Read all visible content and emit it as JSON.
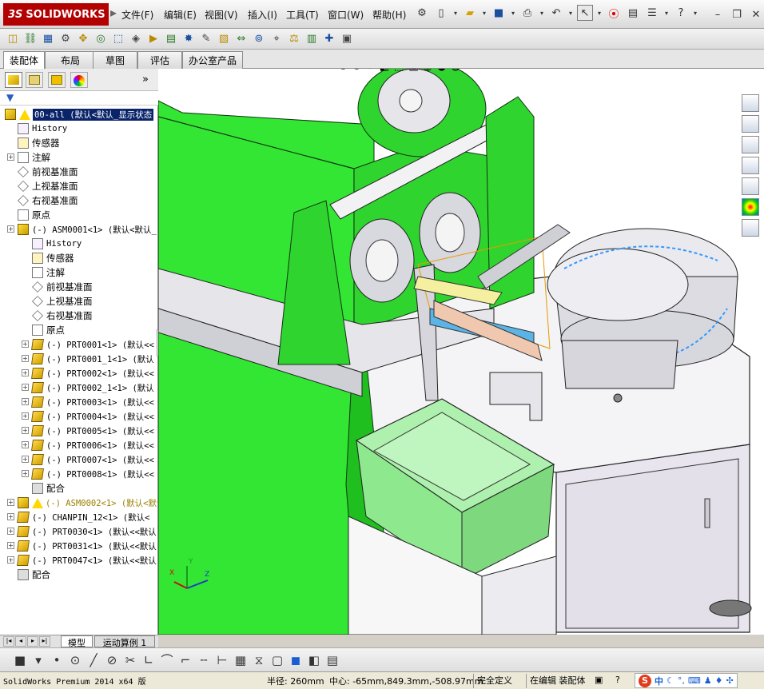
{
  "app": {
    "logo_prefix": "3S",
    "logo_text": "SOLIDWORKS"
  },
  "menu": [
    {
      "label": "文件(F)"
    },
    {
      "label": "编辑(E)"
    },
    {
      "label": "视图(V)"
    },
    {
      "label": "插入(I)"
    },
    {
      "label": "工具(T)"
    },
    {
      "label": "窗口(W)"
    },
    {
      "label": "帮助(H)"
    }
  ],
  "help_glyph": "?",
  "cm_tabs": [
    {
      "label": "装配体",
      "active": true
    },
    {
      "label": "布局",
      "active": false
    },
    {
      "label": "草图",
      "active": false
    },
    {
      "label": "评估",
      "active": false
    },
    {
      "label": "办公室产品",
      "active": false
    }
  ],
  "tree": {
    "root": {
      "label": "00-all  (默认<默认_显示状态",
      "icon": "assembly-warning-icon",
      "selected": true
    },
    "items": [
      {
        "label": "History",
        "icon": "history-icon",
        "indent": 1,
        "mono": true
      },
      {
        "label": "传感器",
        "icon": "sensor-icon",
        "indent": 1
      },
      {
        "label": "注解",
        "icon": "annotation-icon",
        "indent": 1,
        "expand": true
      },
      {
        "label": "前视基准面",
        "icon": "plane-icon",
        "indent": 1
      },
      {
        "label": "上视基准面",
        "icon": "plane-icon",
        "indent": 1
      },
      {
        "label": "右视基准面",
        "icon": "plane-icon",
        "indent": 1
      },
      {
        "label": "原点",
        "icon": "origin-icon",
        "indent": 1
      },
      {
        "label": "(-) ASM0001<1> (默认<默认_",
        "icon": "subassembly-icon",
        "indent": 1,
        "expand": true,
        "mono": true
      },
      {
        "label": "History",
        "icon": "history-icon",
        "indent": 2,
        "mono": true
      },
      {
        "label": "传感器",
        "icon": "sensor-icon",
        "indent": 2
      },
      {
        "label": "注解",
        "icon": "annotation-icon",
        "indent": 2
      },
      {
        "label": "前视基准面",
        "icon": "plane-icon",
        "indent": 2
      },
      {
        "label": "上视基准面",
        "icon": "plane-icon",
        "indent": 2
      },
      {
        "label": "右视基准面",
        "icon": "plane-icon",
        "indent": 2
      },
      {
        "label": "原点",
        "icon": "origin-icon",
        "indent": 2
      },
      {
        "label": "(-) PRT0001<1> (默认<<",
        "icon": "part-icon",
        "indent": 2,
        "expand": true,
        "mono": true
      },
      {
        "label": "(-) PRT0001_1<1> (默认",
        "icon": "part-icon",
        "indent": 2,
        "expand": true,
        "mono": true
      },
      {
        "label": "(-) PRT0002<1> (默认<<",
        "icon": "part-icon",
        "indent": 2,
        "expand": true,
        "mono": true
      },
      {
        "label": "(-) PRT0002_1<1> (默认",
        "icon": "part-icon",
        "indent": 2,
        "expand": true,
        "mono": true
      },
      {
        "label": "(-) PRT0003<1> (默认<<",
        "icon": "part-icon",
        "indent": 2,
        "expand": true,
        "mono": true
      },
      {
        "label": "(-) PRT0004<1> (默认<<",
        "icon": "part-icon",
        "indent": 2,
        "expand": true,
        "mono": true
      },
      {
        "label": "(-) PRT0005<1> (默认<<",
        "icon": "part-icon",
        "indent": 2,
        "expand": true,
        "mono": true
      },
      {
        "label": "(-) PRT0006<1> (默认<<",
        "icon": "part-icon",
        "indent": 2,
        "expand": true,
        "mono": true
      },
      {
        "label": "(-) PRT0007<1> (默认<<",
        "icon": "part-icon",
        "indent": 2,
        "expand": true,
        "mono": true
      },
      {
        "label": "(-) PRT0008<1> (默认<<",
        "icon": "part-icon",
        "indent": 2,
        "expand": true,
        "mono": true
      },
      {
        "label": "配合",
        "icon": "mates-icon",
        "indent": 2
      },
      {
        "label": "(-) ASM0002<1> (默认<默认_",
        "icon": "subassembly-warning-icon",
        "indent": 1,
        "expand": true,
        "mono": true,
        "warn": true
      },
      {
        "label": "(-) CHANPIN_12<1> (默认<",
        "icon": "part-icon",
        "indent": 1,
        "expand": true,
        "mono": true
      },
      {
        "label": "(-) PRT0030<1> (默认<<默认",
        "icon": "part-icon",
        "indent": 1,
        "expand": true,
        "mono": true
      },
      {
        "label": "(-) PRT0031<1> (默认<<默认",
        "icon": "part-icon",
        "indent": 1,
        "expand": true,
        "mono": true
      },
      {
        "label": "(-) PRT0047<1> (默认<<默认",
        "icon": "part-icon",
        "indent": 1,
        "expand": true,
        "mono": true
      },
      {
        "label": "配合",
        "icon": "mates-icon",
        "indent": 1
      }
    ]
  },
  "bottom_tabs": [
    {
      "label": "模型",
      "active": true
    },
    {
      "label": "运动算例 1",
      "active": false
    }
  ],
  "axis_labels": {
    "x": "X",
    "y": "Y",
    "z": "Z"
  },
  "status": {
    "product": "SolidWorks Premium 2014 x64 版",
    "radius": "半径: 260mm",
    "center": "中心: -65mm,849.3mm,-508.97mm",
    "definition": "完全定义",
    "editing": "在编辑 装配体"
  },
  "ime": {
    "label": "中"
  },
  "colors": {
    "frame_green": "#33e633",
    "tree_selection": "#0a246a",
    "logo_red": "#b30000"
  }
}
